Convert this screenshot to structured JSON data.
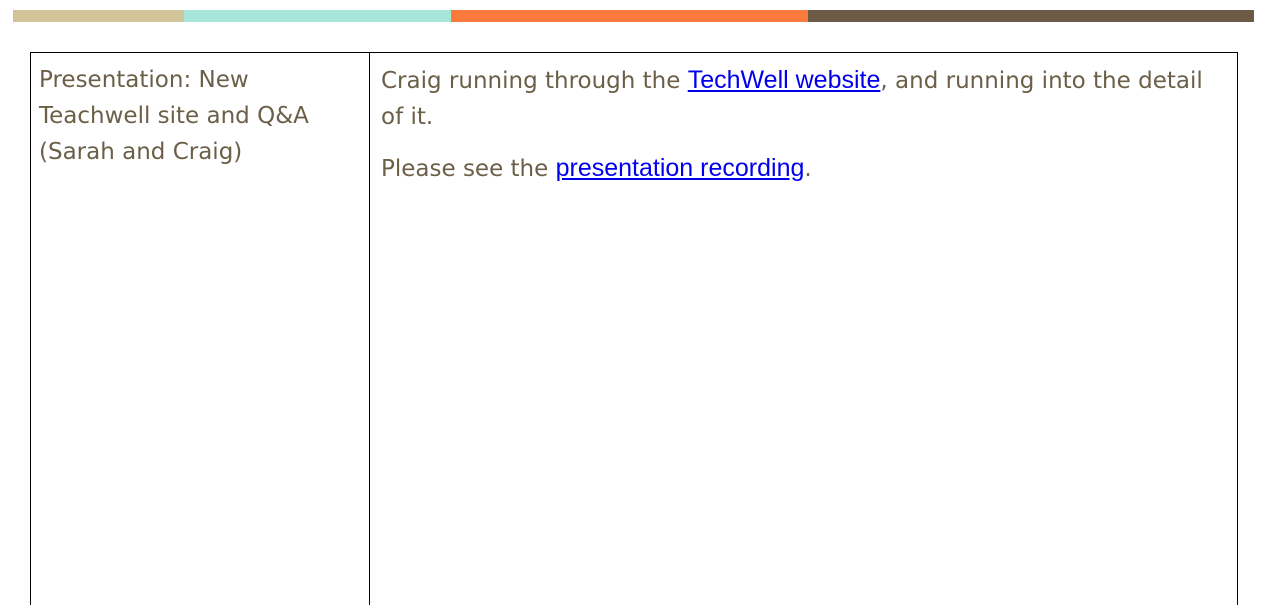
{
  "header_band": {
    "segments": [
      {
        "color": "#d1c39a",
        "flex": 171
      },
      {
        "color": "#a7e6d9",
        "flex": 267
      },
      {
        "color": "#fa7a3c",
        "flex": 357
      },
      {
        "color": "#6b5a44",
        "flex": 446
      }
    ]
  },
  "table": {
    "topic": "Presentation: New Teachwell site and Q&A (Sarah and Craig)",
    "notes": {
      "p1_before": "Craig running through the ",
      "p1_link": "TechWell website",
      "p1_after": ", and running into the detail of it.",
      "p2_before": "Please see the ",
      "p2_link": "presentation recording",
      "p2_after": "."
    }
  },
  "colors": {
    "body_text": "#6b5f48",
    "link": "#0000ee",
    "border": "#000000"
  }
}
